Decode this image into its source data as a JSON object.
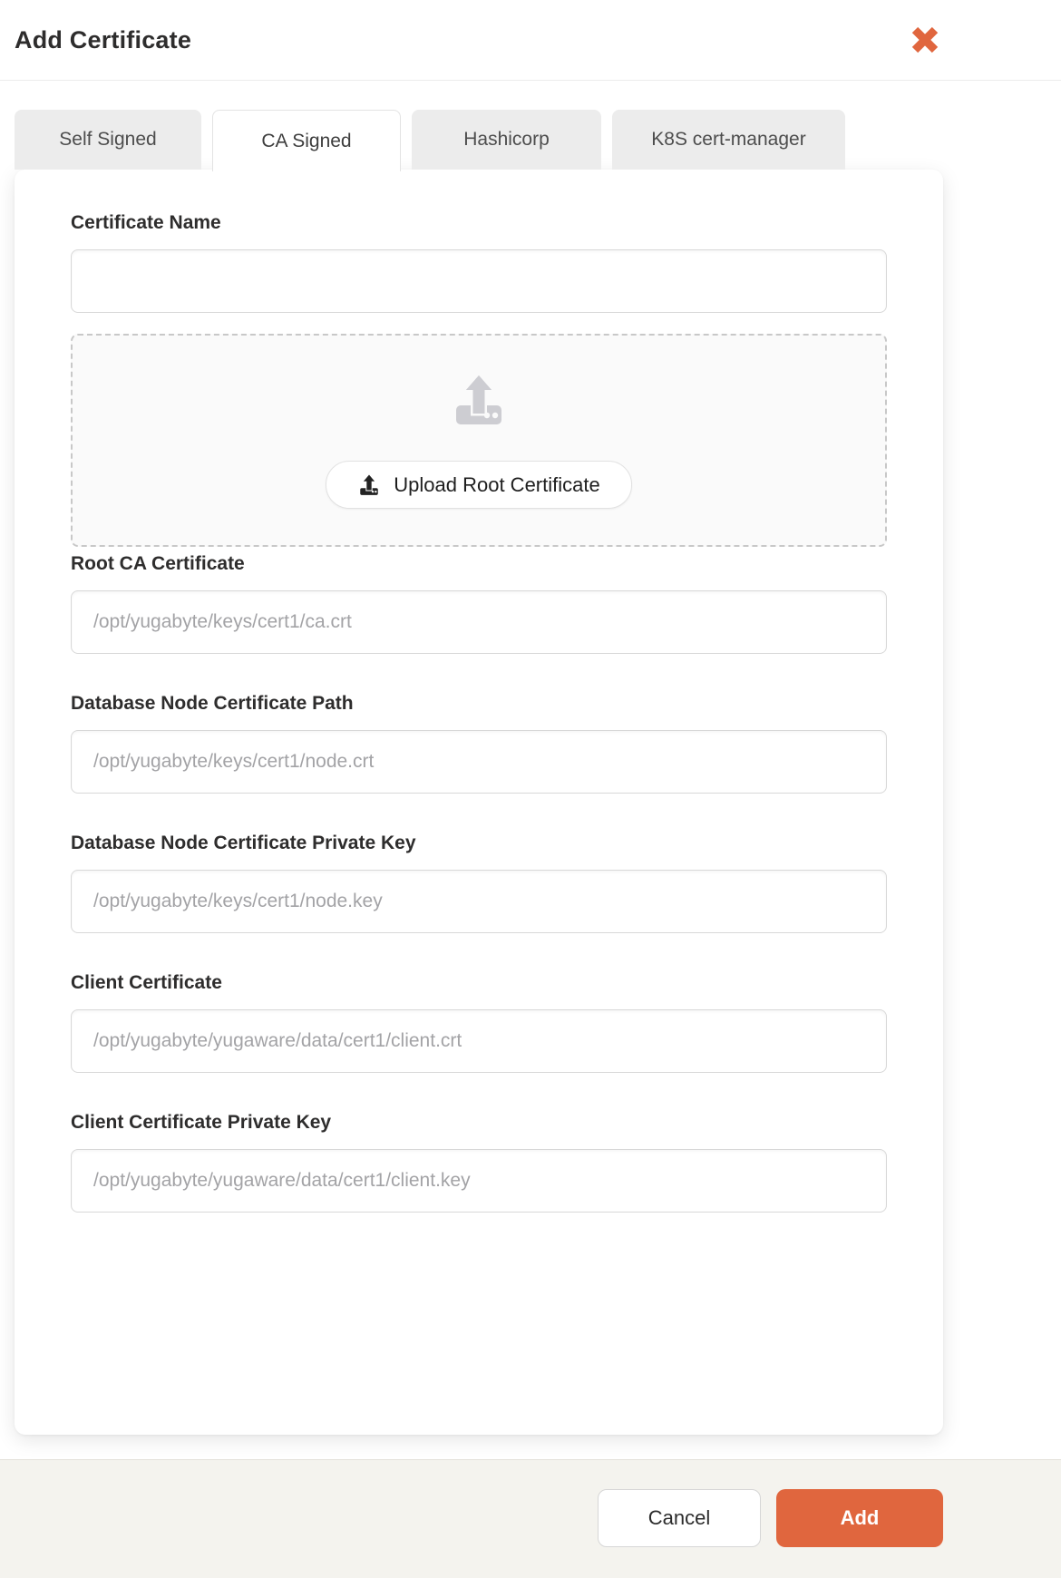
{
  "header": {
    "title": "Add Certificate"
  },
  "tabs": [
    {
      "label": "Self Signed",
      "active": false
    },
    {
      "label": "CA Signed",
      "active": true
    },
    {
      "label": "Hashicorp",
      "active": false
    },
    {
      "label": "K8S cert-manager",
      "active": false
    }
  ],
  "form": {
    "fields": [
      {
        "label": "Certificate Name",
        "value": "",
        "placeholder": ""
      },
      {
        "label": "Root CA Certificate",
        "value": "",
        "placeholder": "/opt/yugabyte/keys/cert1/ca.crt"
      },
      {
        "label": "Database Node Certificate Path",
        "value": "",
        "placeholder": "/opt/yugabyte/keys/cert1/node.crt"
      },
      {
        "label": "Database Node Certificate Private Key",
        "value": "",
        "placeholder": "/opt/yugabyte/keys/cert1/node.key"
      },
      {
        "label": "Client Certificate",
        "value": "",
        "placeholder": "/opt/yugabyte/yugaware/data/cert1/client.crt"
      },
      {
        "label": "Client Certificate Private Key",
        "value": "",
        "placeholder": "/opt/yugabyte/yugaware/data/cert1/client.key"
      }
    ],
    "upload_button_label": "Upload Root Certificate"
  },
  "footer": {
    "cancel_label": "Cancel",
    "add_label": "Add"
  },
  "icons": {
    "close": "close-x-icon",
    "dropzone": "upload-tray-icon",
    "upload_button": "upload-tray-icon-small"
  },
  "colors": {
    "accent_orange": "#e0663e",
    "tab_inactive_bg": "#ececec",
    "footer_bg": "#f4f3ee",
    "placeholder_text": "#a3a3a6"
  }
}
